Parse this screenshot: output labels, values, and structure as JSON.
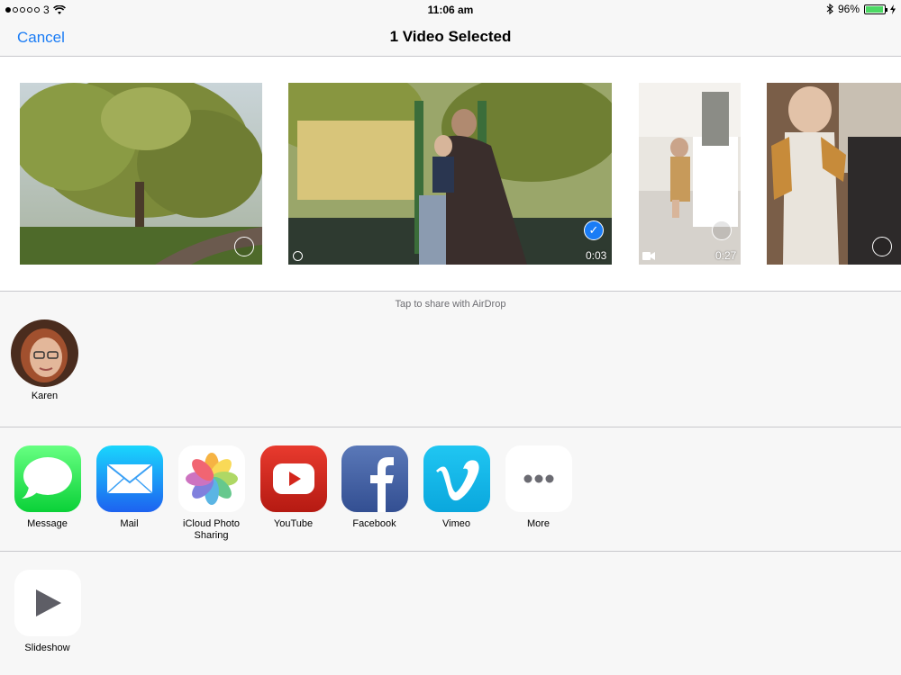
{
  "status": {
    "carrier": "3",
    "time": "11:06 am",
    "battery": "96%",
    "battery_level": 0.96
  },
  "nav": {
    "cancel_label": "Cancel",
    "title": "1 Video Selected"
  },
  "photos": [
    {
      "kind": "photo",
      "selected": false
    },
    {
      "kind": "video",
      "selected": true,
      "duration": "0:03"
    },
    {
      "kind": "video",
      "selected": false,
      "duration": "0:27"
    },
    {
      "kind": "photo",
      "selected": false
    }
  ],
  "airdrop": {
    "hint": "Tap to share with AirDrop",
    "people": [
      {
        "name": "Karen"
      }
    ]
  },
  "share_apps": [
    {
      "label": "Message",
      "icon": "message-icon"
    },
    {
      "label": "Mail",
      "icon": "mail-icon"
    },
    {
      "label": "iCloud Photo Sharing",
      "icon": "photos-icon"
    },
    {
      "label": "YouTube",
      "icon": "youtube-icon"
    },
    {
      "label": "Facebook",
      "icon": "facebook-icon"
    },
    {
      "label": "Vimeo",
      "icon": "vimeo-icon"
    },
    {
      "label": "More",
      "icon": "more-icon"
    }
  ],
  "actions": [
    {
      "label": "Slideshow",
      "icon": "play-icon"
    }
  ],
  "colors": {
    "accent": "#1a7cf5",
    "separator": "#c8c8cc",
    "background": "#f7f7f7"
  }
}
